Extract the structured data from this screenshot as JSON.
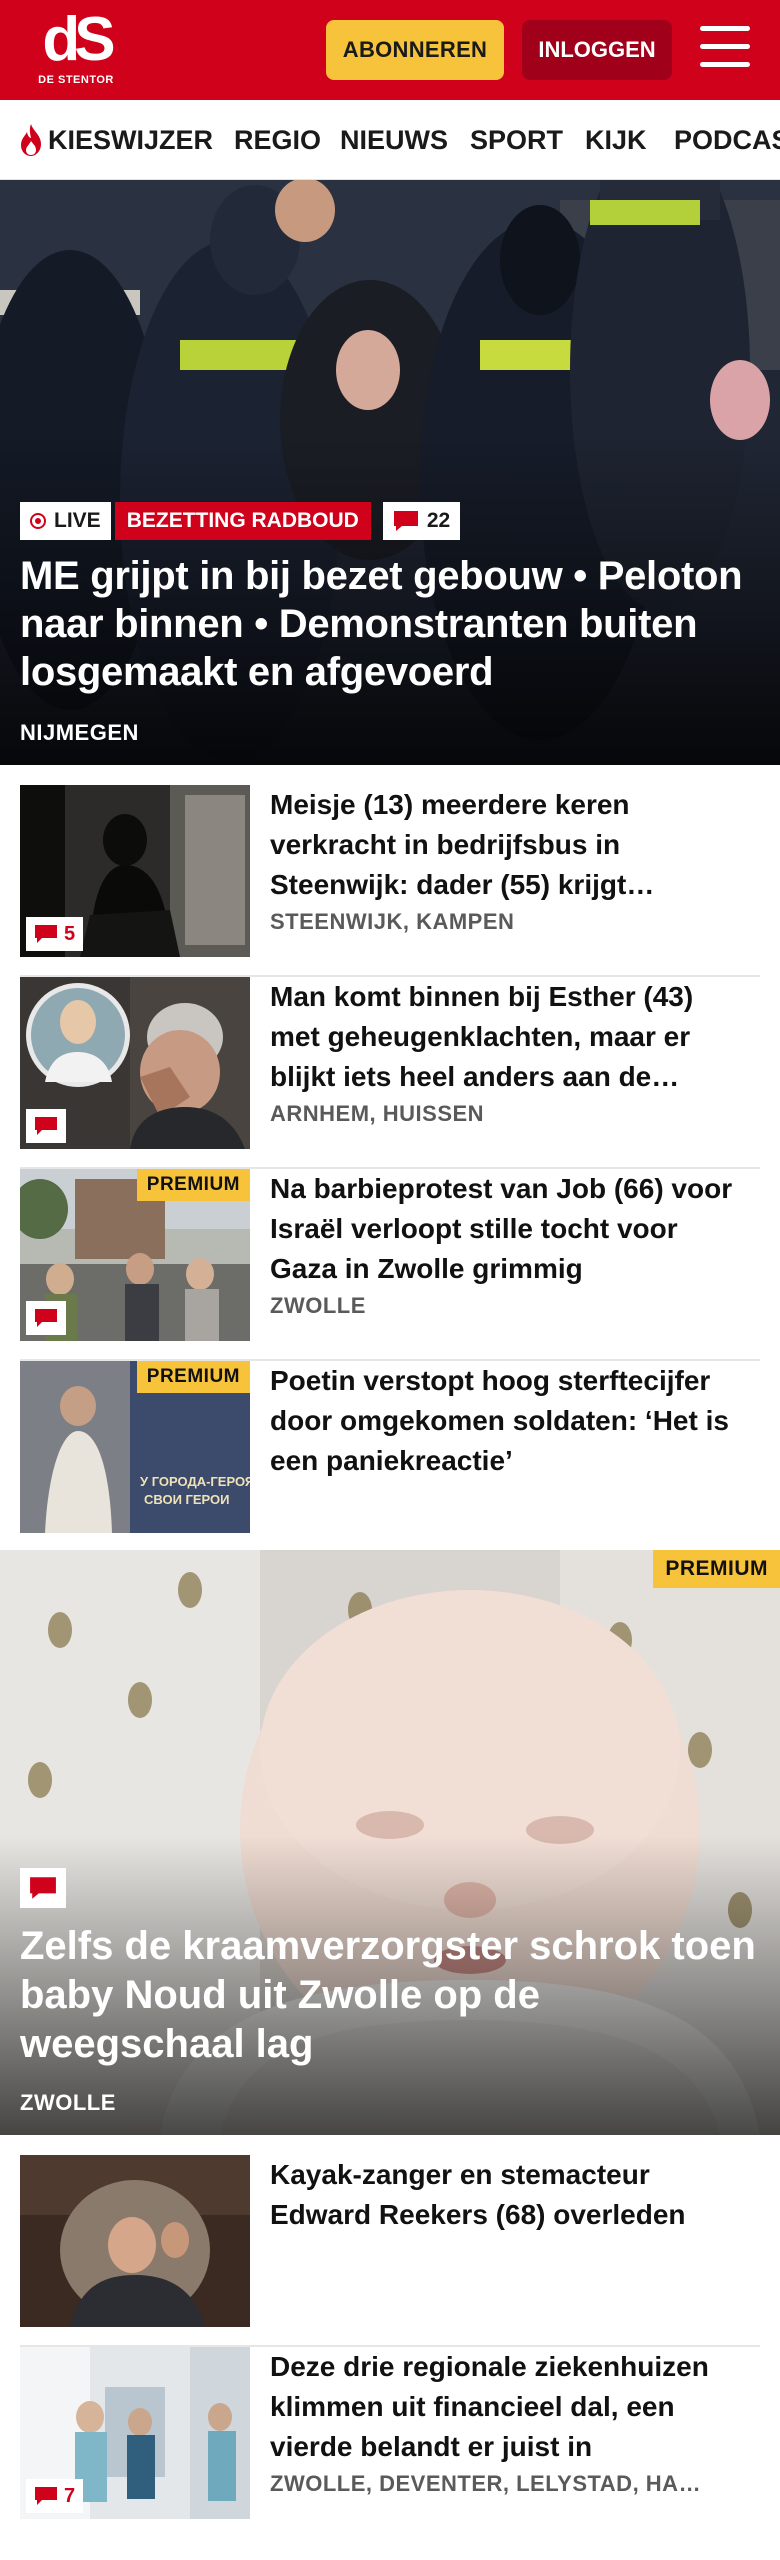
{
  "header": {
    "logo_mark": "dS",
    "logo_sub": "DE STENTOR",
    "subscribe_label": "ABONNEREN",
    "login_label": "INLOGGEN",
    "menu_icon": "hamburger-icon",
    "brand_color": "#d0021b",
    "accent_color": "#f7c33b"
  },
  "nav": {
    "items": [
      {
        "label": "KIESWIJZER",
        "icon": "flame-icon"
      },
      {
        "label": "REGIO"
      },
      {
        "label": "NIEUWS"
      },
      {
        "label": "SPORT"
      },
      {
        "label": "KIJK"
      },
      {
        "label": "PODCASTS"
      }
    ]
  },
  "hero": {
    "live_label": "LIVE",
    "topic_label": "BEZETTING RADBOUD",
    "comment_count": "22",
    "title": "ME grijpt in bij bezet gebouw • Peloton naar binnen • Demonstranten buiten losgemaakt en afgevoerd",
    "location": "NIJMEGEN"
  },
  "articles": [
    {
      "title": "Meisje (13) meerdere keren verkracht in bedrijfsbus in Steenwijk: dader (55) krijgt…",
      "location": "STEENWIJK, KAMPEN",
      "comment_count": "5",
      "premium": ""
    },
    {
      "title": "Man komt binnen bij Esther (43) met geheugenklachten, maar er blijkt iets heel anders aan de…",
      "location": "ARNHEM, HUISSEN",
      "comment_count": "",
      "premium": ""
    },
    {
      "title": "Na barbieprotest van Job (66) voor Israël verloopt stille tocht voor Gaza in Zwolle grimmig",
      "location": "ZWOLLE",
      "comment_count": "",
      "premium": "PREMIUM"
    },
    {
      "title": "Poetin verstopt hoog sterftecijfer door omgekomen soldaten: ‘Het is een paniekreactie’",
      "location": "",
      "comment_count": "",
      "premium": "PREMIUM",
      "thumb_text_1": "У ГОРОДА-ГЕРОЯ",
      "thumb_text_2": "СВОИ ГЕРОИ"
    }
  ],
  "feature": {
    "premium": "PREMIUM",
    "title": "Zelfs de kraamverzorgster schrok toen baby Noud uit Zwolle op de weegschaal lag",
    "location": "ZWOLLE"
  },
  "articles_bottom": [
    {
      "title": "Kayak-zanger en stemacteur Edward Reekers (68) overleden",
      "location": "",
      "comment_count": ""
    },
    {
      "title": "Deze drie regionale ziekenhuizen klimmen uit financieel dal, een vierde belandt er juist in",
      "location": "ZWOLLE, DEVENTER, LELYSTAD, HA…",
      "comment_count": "7"
    }
  ]
}
